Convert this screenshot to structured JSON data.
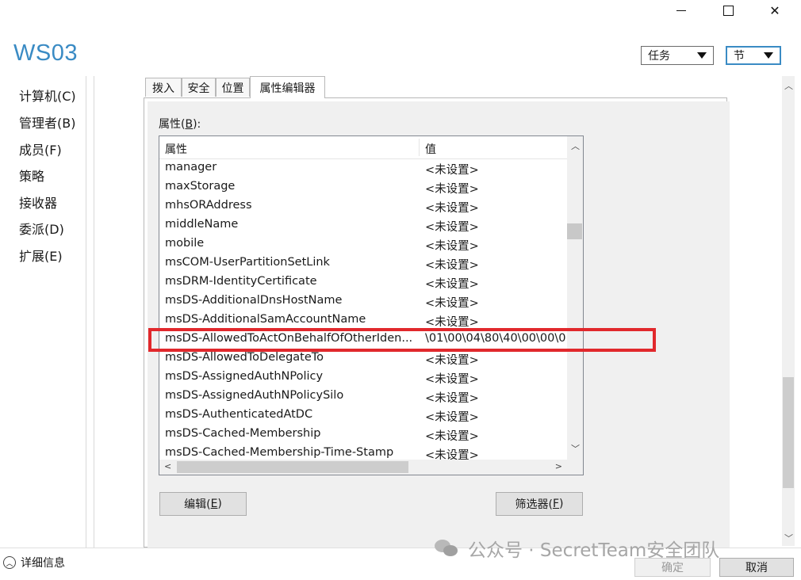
{
  "window": {
    "title": "WS03"
  },
  "header": {
    "tasks_label": "任务",
    "section_label": "节"
  },
  "leftnav": {
    "items": [
      "计算机(C)",
      "管理者(B)",
      "成员(F)",
      "策略",
      "接收器",
      "委派(D)",
      "扩展(E)"
    ]
  },
  "tabs": [
    {
      "label": "拨入",
      "active": false
    },
    {
      "label": "安全",
      "active": false
    },
    {
      "label": "位置",
      "active": false
    },
    {
      "label": "属性编辑器",
      "active": true
    }
  ],
  "attributes": {
    "label_prefix": "属性(",
    "label_key": "B",
    "label_suffix": "):",
    "col_name": "属性",
    "col_value": "值",
    "rows": [
      {
        "name": "manager",
        "value": "<未设置>"
      },
      {
        "name": "maxStorage",
        "value": "<未设置>"
      },
      {
        "name": "mhsORAddress",
        "value": "<未设置>"
      },
      {
        "name": "middleName",
        "value": "<未设置>"
      },
      {
        "name": "mobile",
        "value": "<未设置>"
      },
      {
        "name": "msCOM-UserPartitionSetLink",
        "value": "<未设置>"
      },
      {
        "name": "msDRM-IdentityCertificate",
        "value": "<未设置>"
      },
      {
        "name": "msDS-AdditionalDnsHostName",
        "value": "<未设置>"
      },
      {
        "name": "msDS-AdditionalSamAccountName",
        "value": "<未设置>"
      },
      {
        "name": "msDS-AllowedToActOnBehalfOfOtherIden...",
        "value": "\\01\\00\\04\\80\\40\\00\\00\\0"
      },
      {
        "name": "msDS-AllowedToDelegateTo",
        "value": "<未设置>"
      },
      {
        "name": "msDS-AssignedAuthNPolicy",
        "value": "<未设置>"
      },
      {
        "name": "msDS-AssignedAuthNPolicySilo",
        "value": "<未设置>"
      },
      {
        "name": "msDS-AuthenticatedAtDC",
        "value": "<未设置>"
      },
      {
        "name": "msDS-Cached-Membership",
        "value": "<未设置>"
      },
      {
        "name": "msDS-Cached-Membership-Time-Stamp",
        "value": "<未设置>"
      }
    ]
  },
  "buttons": {
    "edit_prefix": "编辑(",
    "edit_key": "E",
    "edit_suffix": ")",
    "filter_prefix": "筛选器(",
    "filter_key": "F",
    "filter_suffix": ")",
    "ok": "确定",
    "cancel": "取消"
  },
  "footer": {
    "details": "详细信息",
    "watermark": "公众号 · SecretTeam安全团队"
  },
  "colors": {
    "accent": "#3a8bc4",
    "highlight": "#e1282c"
  },
  "icons": {
    "minimize": "minimize-icon",
    "maximize": "maximize-icon",
    "close": "close-icon",
    "dropdown": "chevron-down-icon",
    "details_toggle": "chevron-up-circle-icon",
    "wechat": "wechat-icon"
  }
}
